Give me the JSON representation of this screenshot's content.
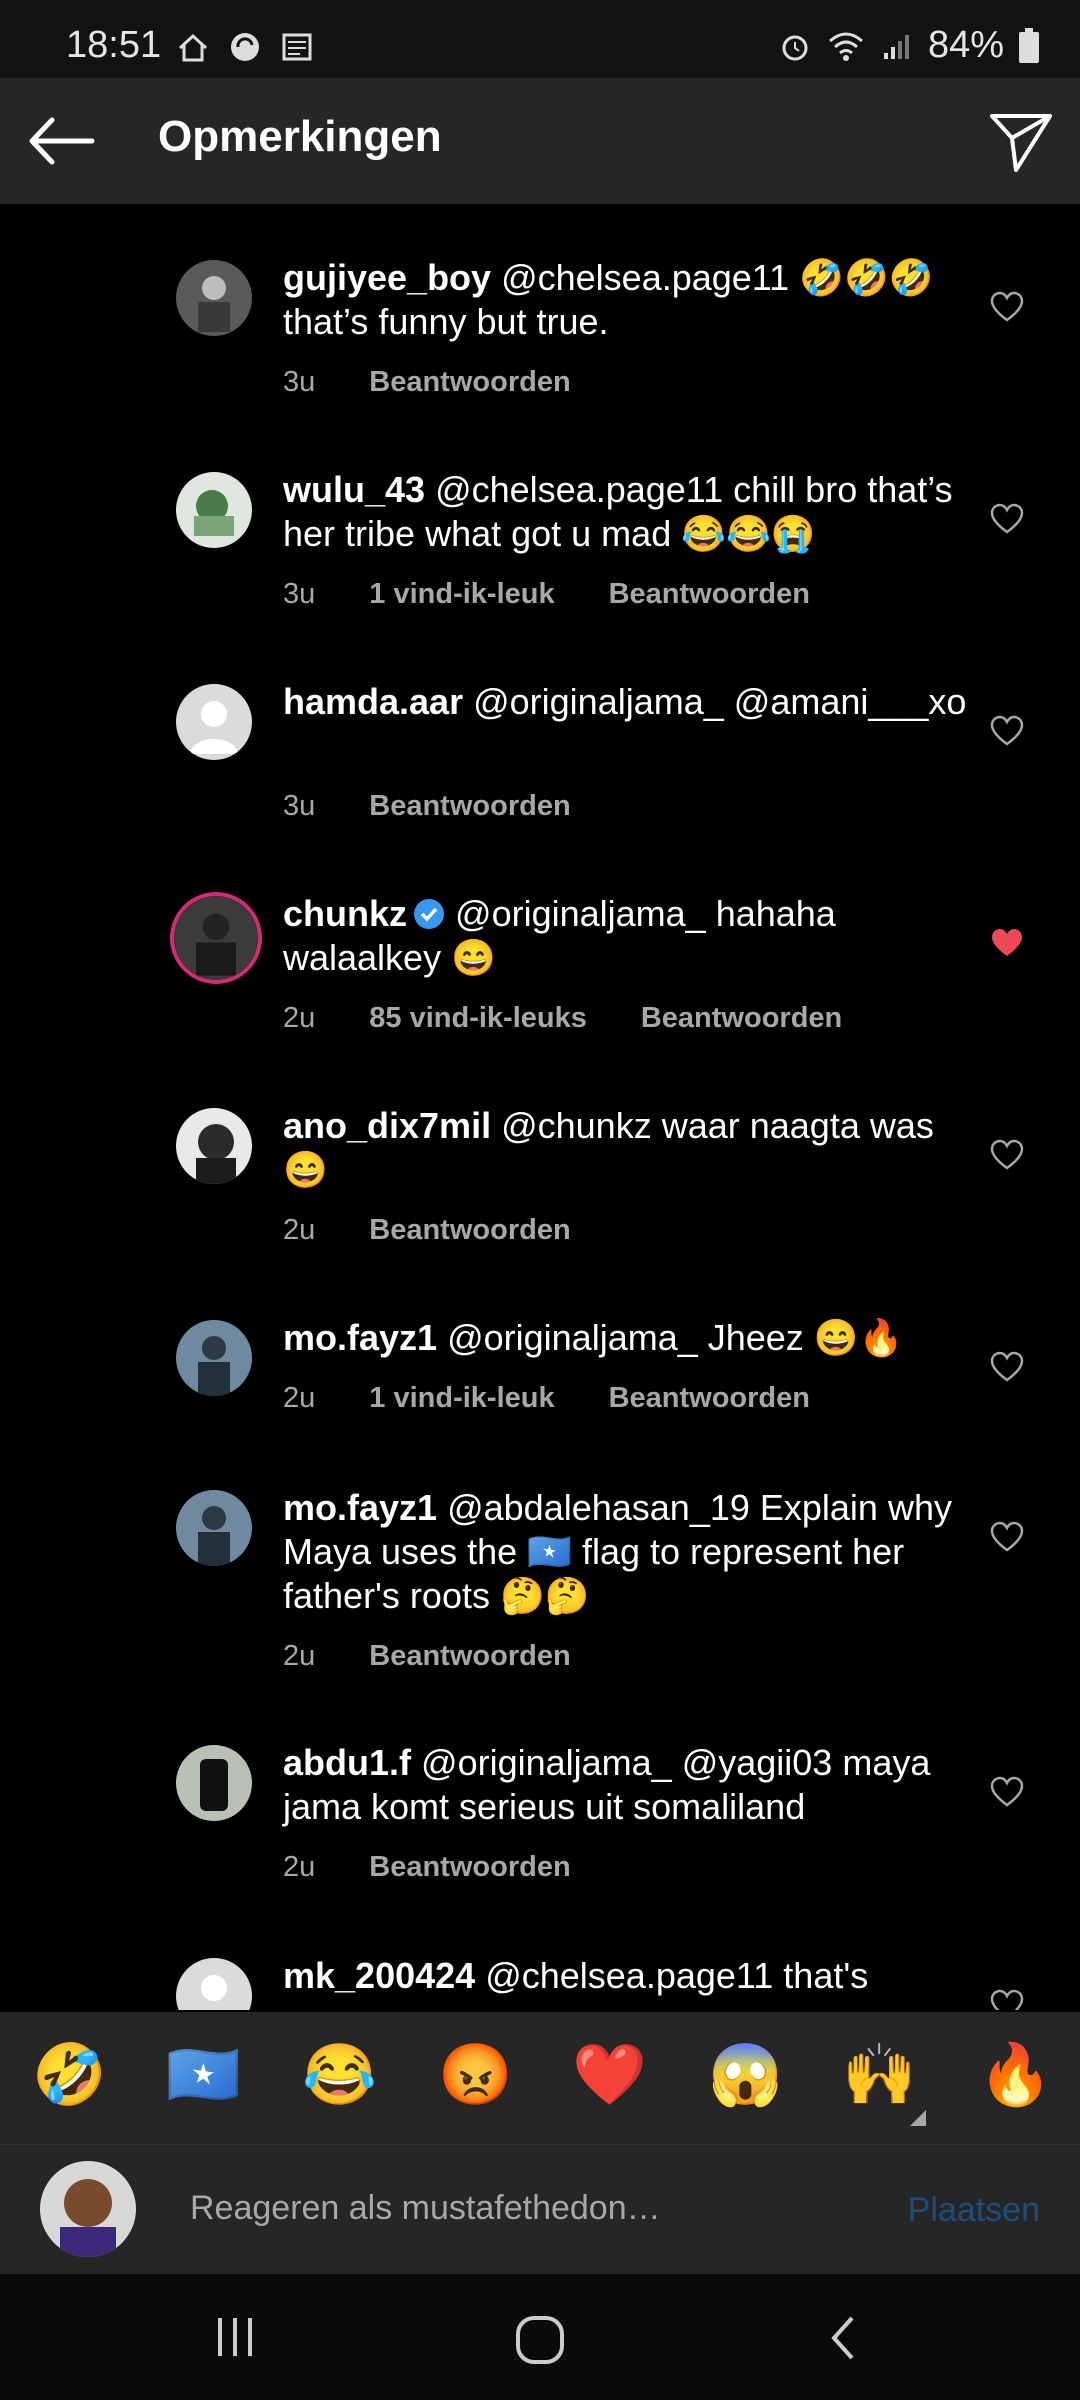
{
  "status": {
    "time": "18:51",
    "battery": "84%"
  },
  "header": {
    "title": "Opmerkingen"
  },
  "comments": [
    {
      "user": "gujiyee_boy",
      "text": "@chelsea.page11 🤣🤣🤣 that’s funny but true.",
      "time": "3u",
      "likes": "",
      "reply": "Beantwoorden"
    },
    {
      "user": "wulu_43",
      "text": "@chelsea.page11  chill bro that’s her tribe what got u mad 😂😂😭",
      "time": "3u",
      "likes": "1 vind-ik-leuk",
      "reply": "Beantwoorden"
    },
    {
      "user": "hamda.aar",
      "text": "@originaljama_ @amani___xo",
      "time": "3u",
      "likes": "",
      "reply": "Beantwoorden"
    },
    {
      "user": "chunkz",
      "text": "@originaljama_ hahaha walaalkey 😄",
      "time": "2u",
      "likes": "85 vind-ik-leuks",
      "reply": "Beantwoorden"
    },
    {
      "user": "ano_dix7mil",
      "text": "@chunkz waar naagta was 😄",
      "time": "2u",
      "likes": "",
      "reply": "Beantwoorden"
    },
    {
      "user": "mo.fayz1",
      "text": "@originaljama_ Jheez 😄🔥",
      "time": "2u",
      "likes": "1 vind-ik-leuk",
      "reply": "Beantwoorden"
    },
    {
      "user": "mo.fayz1",
      "text": "@abdalehasan_19 Explain why Maya uses the 🇸🇴 flag to represent her father's roots 🤔🤔",
      "time": "2u",
      "likes": "",
      "reply": "Beantwoorden"
    },
    {
      "user": "abdu1.f",
      "text": "@originaljama_ @yagii03 maya jama komt serieus uit somaliland",
      "time": "2u",
      "likes": "",
      "reply": "Beantwoorden"
    },
    {
      "user": "mk_200424",
      "text": "@chelsea.page11 that's"
    }
  ],
  "emojis": [
    "🤣",
    "🇸🇴",
    "😂",
    "😡",
    "❤️",
    "😱",
    "🙌",
    "🔥"
  ],
  "composer": {
    "placeholder": "Reageren als mustafethedon…",
    "post": "Plaatsen"
  },
  "colors": {
    "like_red": "#ed4956",
    "verified_blue": "#3897f0",
    "story_ring": "#d62976"
  },
  "icons": {
    "back": "arrow-left-icon",
    "share": "paper-plane-icon",
    "heart": "heart-icon"
  }
}
